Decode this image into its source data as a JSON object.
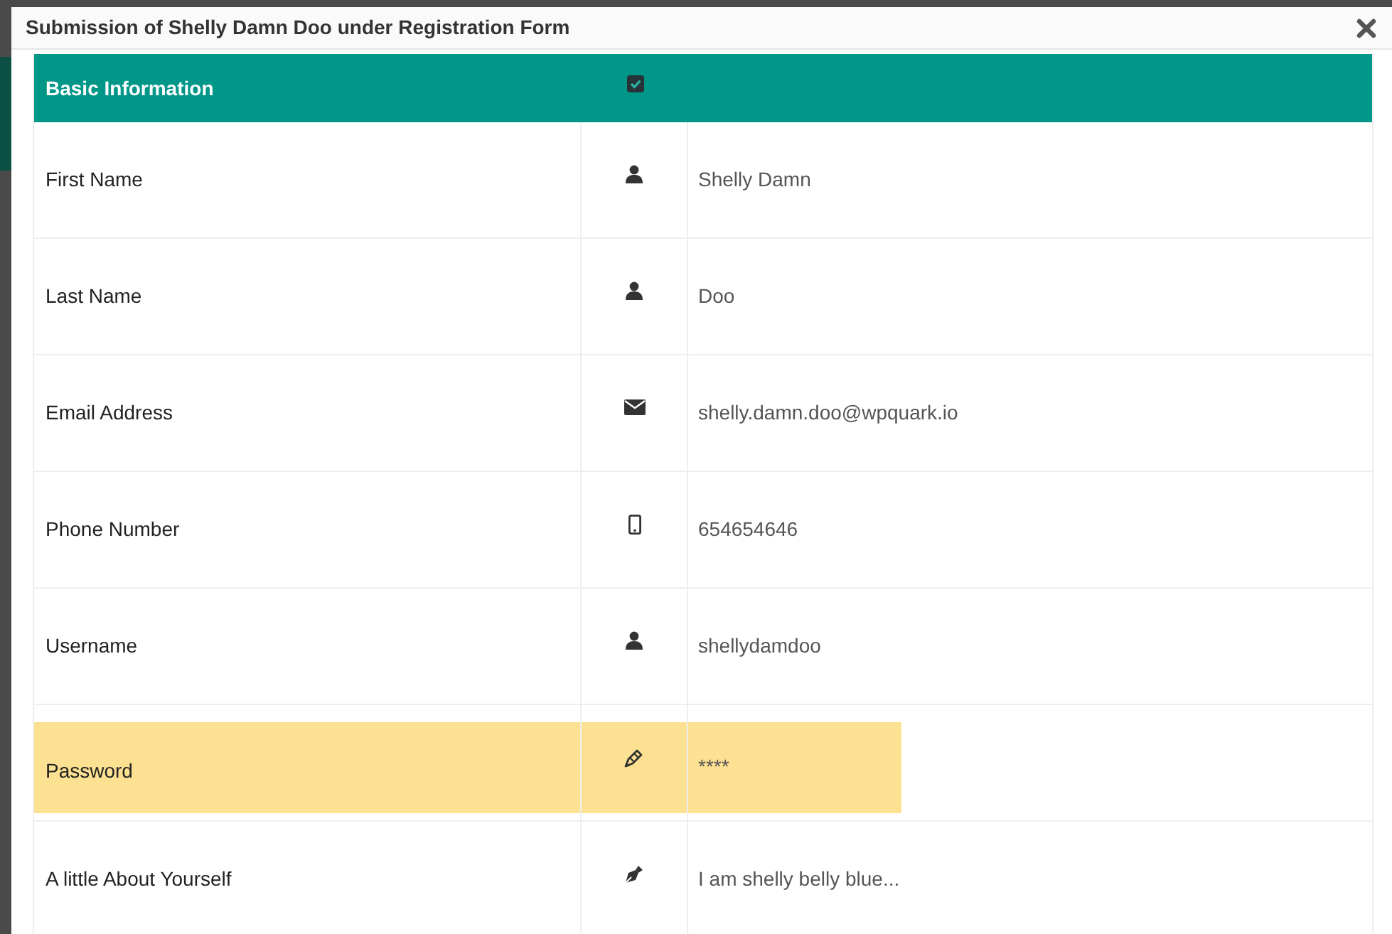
{
  "modal": {
    "title": "Submission of Shelly Damn Doo under Registration Form"
  },
  "section": {
    "title": "Basic Information"
  },
  "fields": [
    {
      "kind": "text",
      "label": "First Name",
      "value": "Shelly Damn",
      "highlighted": false
    },
    {
      "kind": "text",
      "label": "Last Name",
      "value": "Doo",
      "highlighted": false
    },
    {
      "kind": "email",
      "label": "Email Address",
      "value": "shelly.damn.doo@wpquark.io",
      "highlighted": false
    },
    {
      "kind": "phone",
      "label": "Phone Number",
      "value": "654654646",
      "highlighted": false
    },
    {
      "kind": "text",
      "label": "Username",
      "value": "shellydamdoo",
      "highlighted": false
    },
    {
      "kind": "password",
      "label": "Password",
      "value": "****",
      "highlighted": true
    },
    {
      "kind": "textarea",
      "label": "A little About Yourself",
      "value": "I am shelly belly blue...",
      "highlighted": false
    }
  ]
}
